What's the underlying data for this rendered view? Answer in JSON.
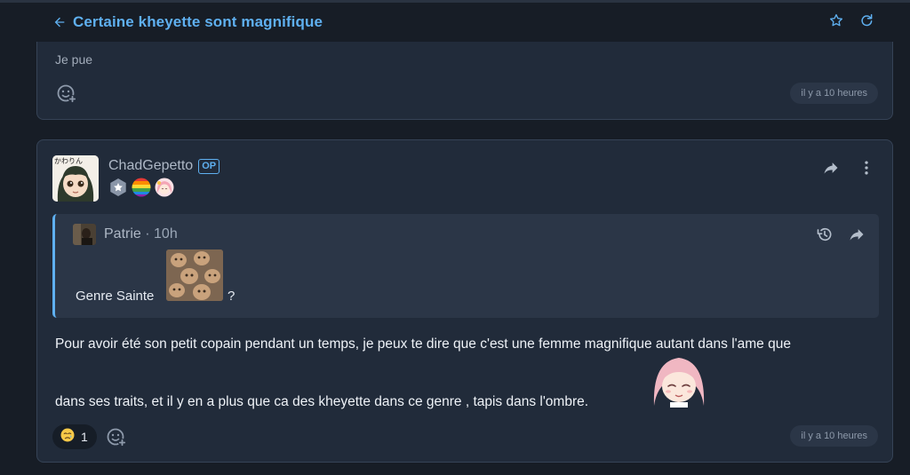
{
  "topbar": {
    "title": "Certaine kheyette sont magnifique",
    "back_icon": "arrow-left-icon",
    "favorite_icon": "star-outline-icon",
    "refresh_icon": "refresh-icon"
  },
  "colors": {
    "accent": "#5fb0f0",
    "background": "#171d26",
    "card": "#212b3a",
    "quote": "#2b3647"
  },
  "previous_post": {
    "text": "Je pue",
    "time": "il y a 10 heures",
    "add_reaction_icon": "add-reaction-icon"
  },
  "post": {
    "author": "ChadGepetto",
    "op_badge": "OP",
    "badges": [
      "star-badge-icon",
      "rainbow-badge-icon",
      "anime-girl-badge-icon"
    ],
    "share_icon": "share-arrow-icon",
    "menu_icon": "more-vertical-icon",
    "quote": {
      "author": "Patrie",
      "time": "· 10h",
      "text_before": "Genre Sainte",
      "text_after": "?",
      "history_icon": "history-icon",
      "share_icon": "share-arrow-icon"
    },
    "line1": "Pour avoir été son petit copain pendant un temps, je peux te dire que c'est une femme magnifique autant dans l'ame que",
    "line2": "dans ses traits, et il y en a plus que ca des kheyette dans ce genre , tapis dans l'ombre.",
    "reaction": {
      "emoji": "😢",
      "count": "1"
    },
    "time": "il y a 10 heures"
  }
}
